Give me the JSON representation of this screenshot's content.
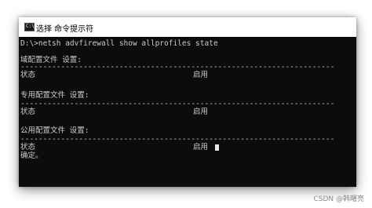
{
  "window": {
    "title": "选择 命令提示符",
    "icon": "cmd-icon"
  },
  "console": {
    "command": "D:\\>netsh advfirewall show allprofiles state",
    "profiles": [
      {
        "header": "域配置文件 设置:",
        "separator": "----------------------------------------------------------------------",
        "state_label": "状态",
        "state_value": "启用"
      },
      {
        "header": "专用配置文件 设置:",
        "separator": "----------------------------------------------------------------------",
        "state_label": "状态",
        "state_value": "启用"
      },
      {
        "header": "公用配置文件 设置:",
        "separator": "----------------------------------------------------------------------",
        "state_label": "状态",
        "state_value": "启用"
      }
    ],
    "ok_text": "确定。"
  },
  "watermark": "CSDN @韩曙亮"
}
